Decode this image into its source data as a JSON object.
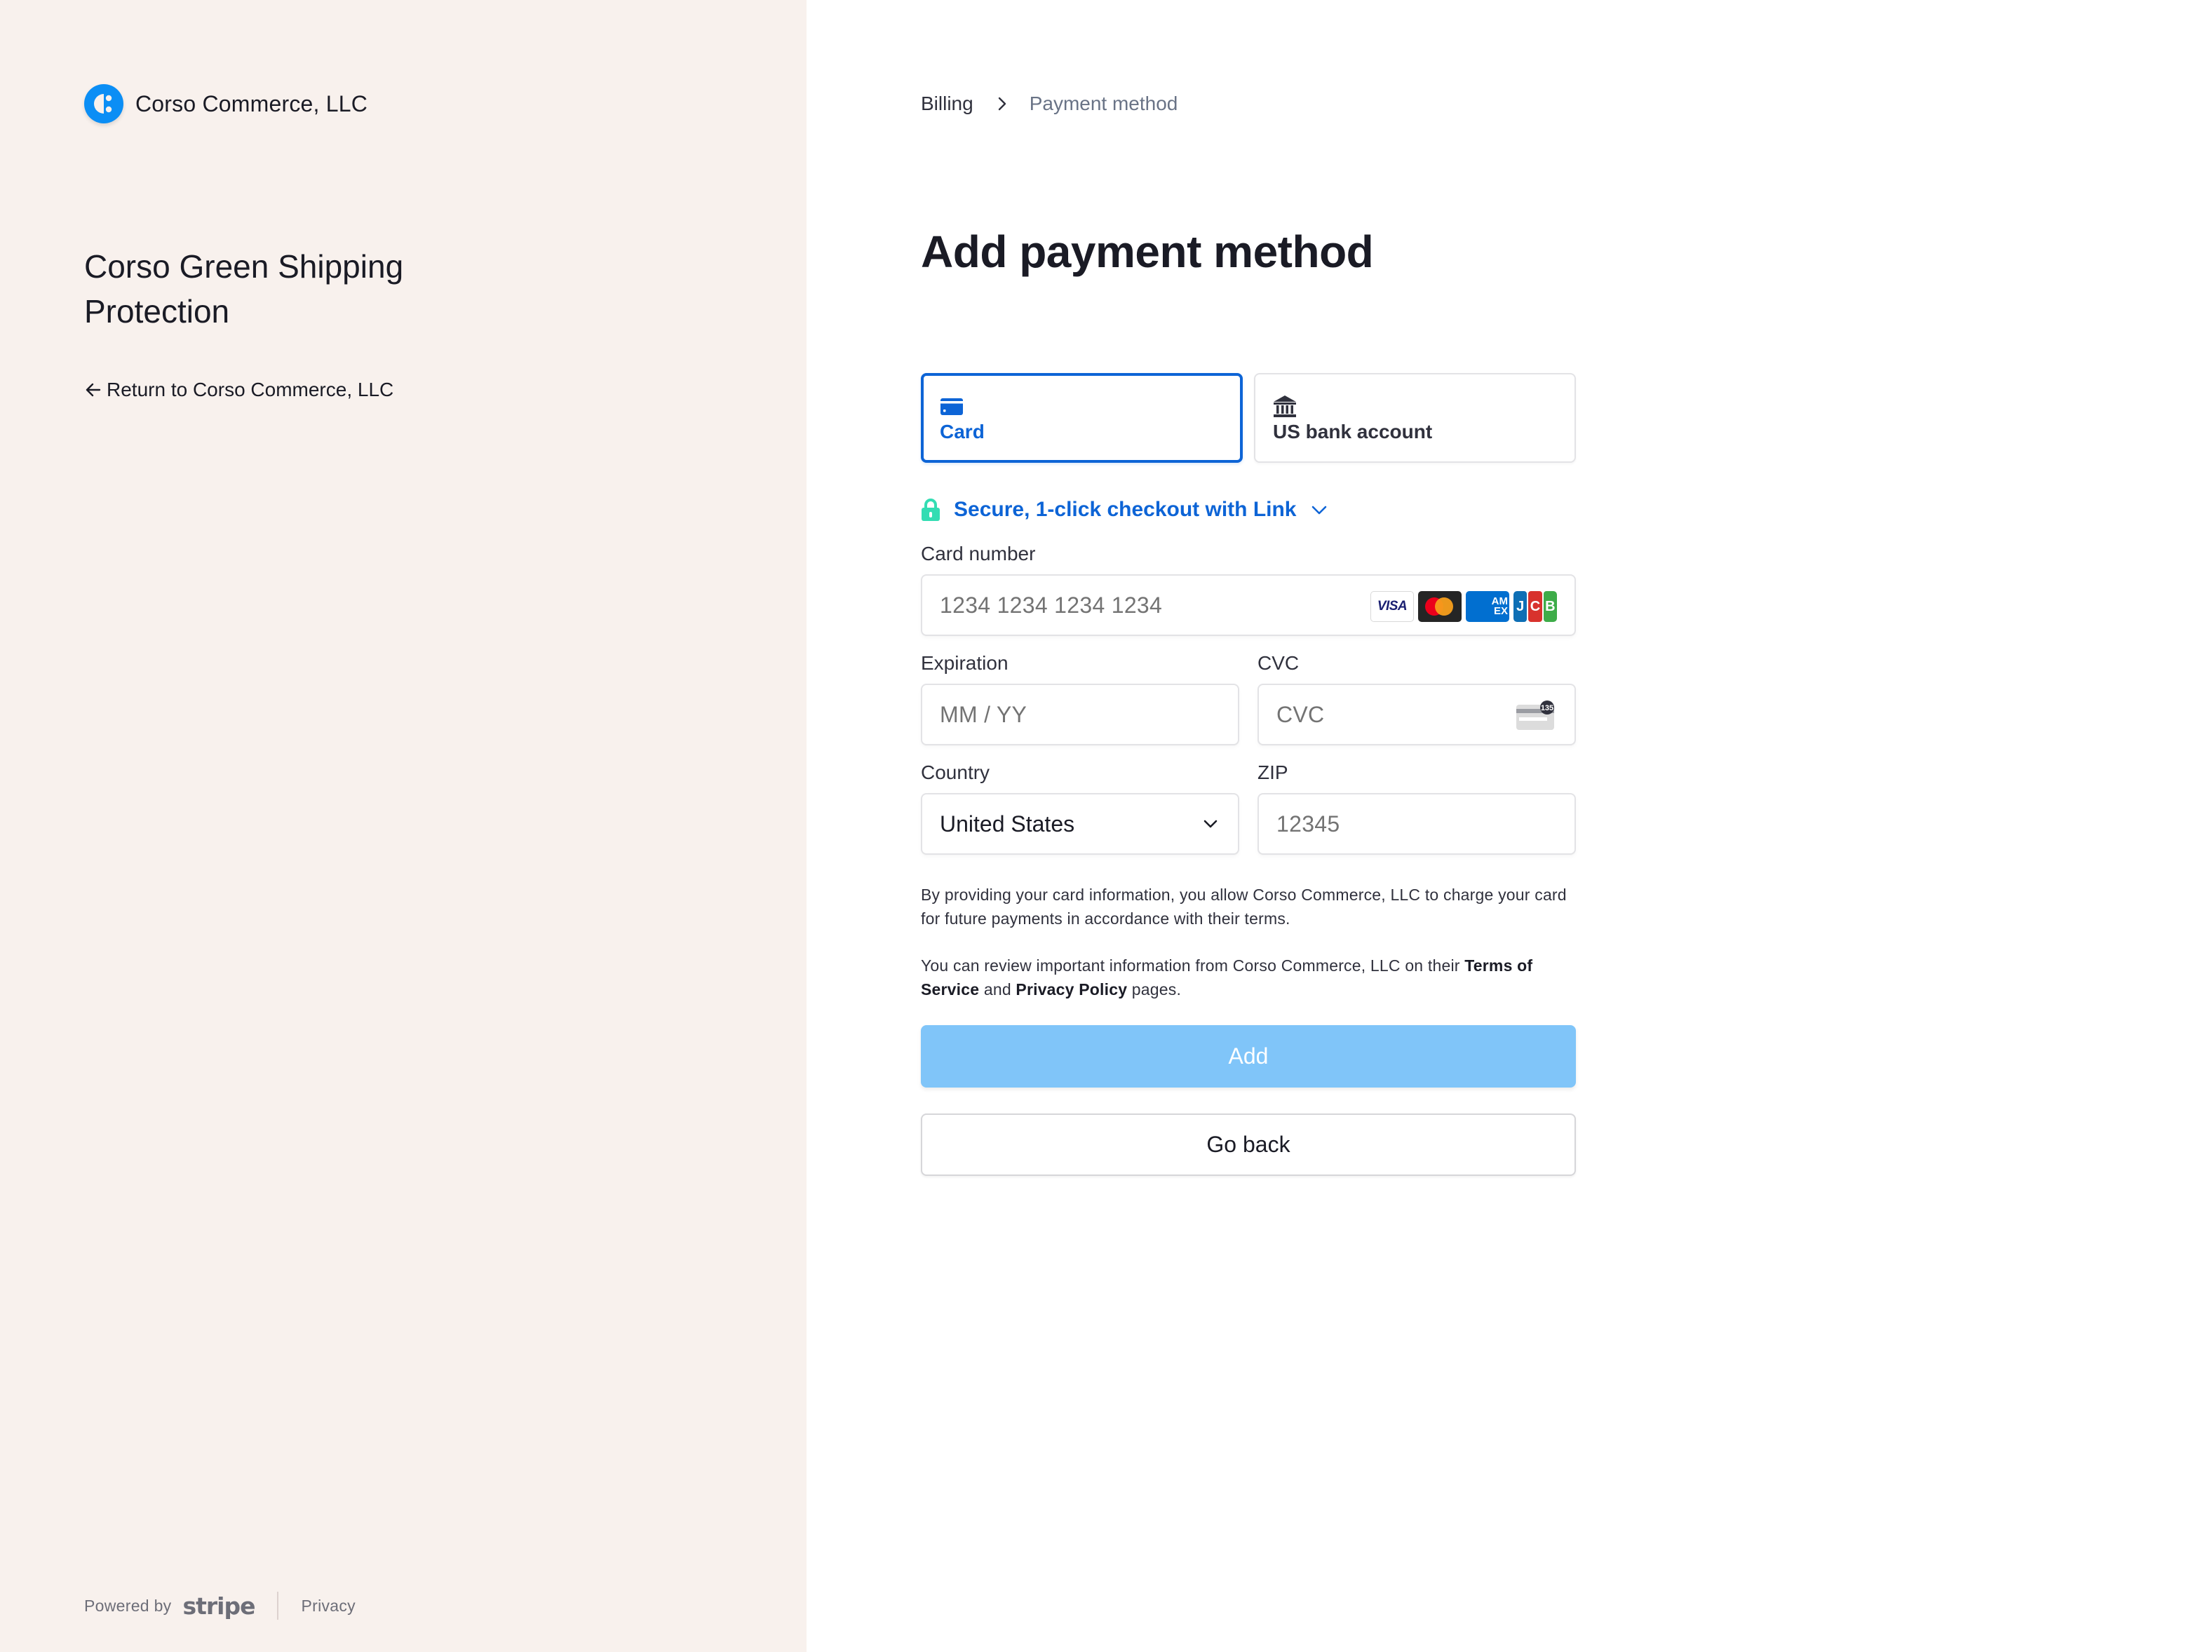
{
  "merchant": {
    "name": "Corso Commerce, LLC",
    "logo_icon": "corso-logo-icon",
    "brand_color": "#0b8ef5"
  },
  "product": {
    "title": "Corso Green Shipping Protection"
  },
  "return_link": {
    "icon": "arrow-left-icon",
    "label": "Return to Corso Commerce, LLC"
  },
  "footer": {
    "powered_by": "Powered by",
    "stripe_logo": "stripe",
    "privacy": "Privacy"
  },
  "breadcrumb": {
    "items": [
      {
        "label": "Billing"
      },
      {
        "label": "Payment method"
      }
    ],
    "separator_icon": "chevron-right-icon"
  },
  "page": {
    "title": "Add payment method"
  },
  "payment_tabs": [
    {
      "label": "Card",
      "icon": "credit-card-icon",
      "selected": true
    },
    {
      "label": "US bank account",
      "icon": "bank-icon",
      "selected": false
    }
  ],
  "link_checkout": {
    "icon": "lock-icon",
    "label": "Secure, 1-click checkout with Link",
    "chevron_icon": "chevron-down-icon",
    "icon_color": "#33ddb3",
    "text_color": "#0d64d6"
  },
  "fields": {
    "card_number": {
      "label": "Card number",
      "placeholder": "1234 1234 1234 1234",
      "value": ""
    },
    "card_brands": [
      {
        "name": "visa",
        "text": "VISA"
      },
      {
        "name": "mastercard",
        "text": ""
      },
      {
        "name": "amex",
        "text_top": "AM",
        "text_bottom": "EX"
      },
      {
        "name": "jcb",
        "letters": [
          "J",
          "C",
          "B"
        ]
      }
    ],
    "expiration": {
      "label": "Expiration",
      "placeholder": "MM / YY",
      "value": ""
    },
    "cvc": {
      "label": "CVC",
      "placeholder": "CVC",
      "value": "",
      "icon": "cvc-card-icon",
      "icon_badge": "135"
    },
    "country": {
      "label": "Country",
      "value": "United States"
    },
    "zip": {
      "label": "ZIP",
      "placeholder": "12345",
      "value": ""
    }
  },
  "terms": {
    "mandate": "By providing your card information, you allow Corso Commerce, LLC to charge your card for future payments in accordance with their terms.",
    "review_prefix": "You can review important information from Corso Commerce, LLC on their ",
    "terms_of_service": "Terms of Service",
    "and": " and ",
    "privacy_policy": "Privacy Policy",
    "review_suffix": " pages."
  },
  "actions": {
    "add": "Add",
    "add_color": "#80c5f9",
    "go_back": "Go back"
  }
}
